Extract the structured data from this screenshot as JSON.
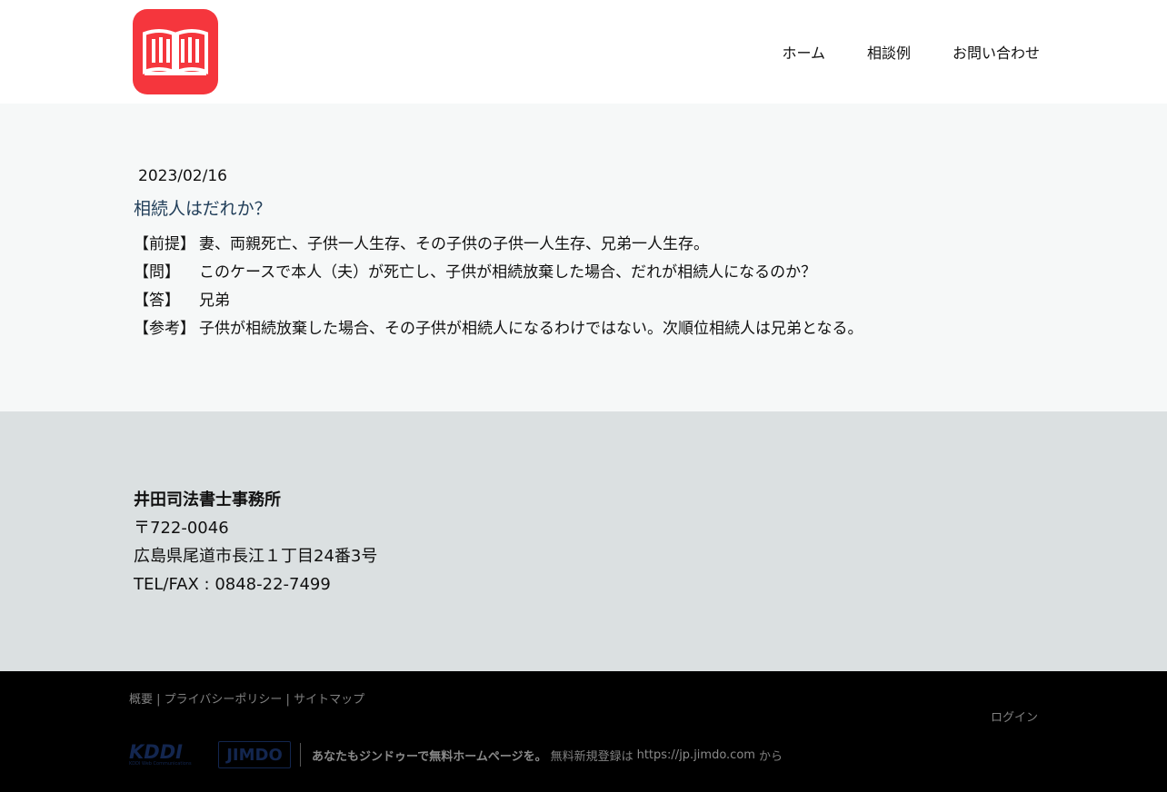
{
  "header": {
    "nav": [
      {
        "label": "ホーム"
      },
      {
        "label": "相談例"
      },
      {
        "label": "お問い合わせ"
      }
    ]
  },
  "post": {
    "date": "2023/02/16",
    "title": "相続人はだれか？",
    "rows": [
      {
        "key": "【前提】",
        "text": "妻、両親死亡、子供一人生存、その子供の子供一人生存、兄弟一人生存。"
      },
      {
        "key": "【問】",
        "text": "このケースで本人（夫）が死亡し、子供が相続放棄した場合、だれが相続人になるのか？"
      },
      {
        "key": "【答】",
        "text": "兄弟"
      },
      {
        "key": "【参考】",
        "text": "子供が相続放棄した場合、その子供が相続人になるわけではない。次順位相続人は兄弟となる。"
      }
    ]
  },
  "office": {
    "name": "井田司法書士事務所",
    "postal": "〒722-0046",
    "address": "広島県尾道市長江１丁目24番3号",
    "tel": "TEL/FAX : 0848-22-7499"
  },
  "footer": {
    "links": [
      "概要",
      "プライバシーポリシー",
      "サイトマップ"
    ],
    "separator": " | ",
    "login": "ログイン",
    "kddi": "KDDI",
    "kddi_sub": "KDDI Web Communications",
    "jimdo": "JIMDO",
    "promo_bold": "あなたもジンドゥーで無料ホームページを。",
    "promo_text": "無料新規登録は",
    "promo_url": "https://jp.jimdo.com",
    "promo_suffix": "から"
  },
  "colors": {
    "logo_red": "#f5363d",
    "title_blue": "#223f5a",
    "main_bg": "#f6f8f8",
    "info_bg": "#dbe0e1",
    "footer_bg": "#000000"
  },
  "icons": {
    "logo": "open-book-icon"
  }
}
